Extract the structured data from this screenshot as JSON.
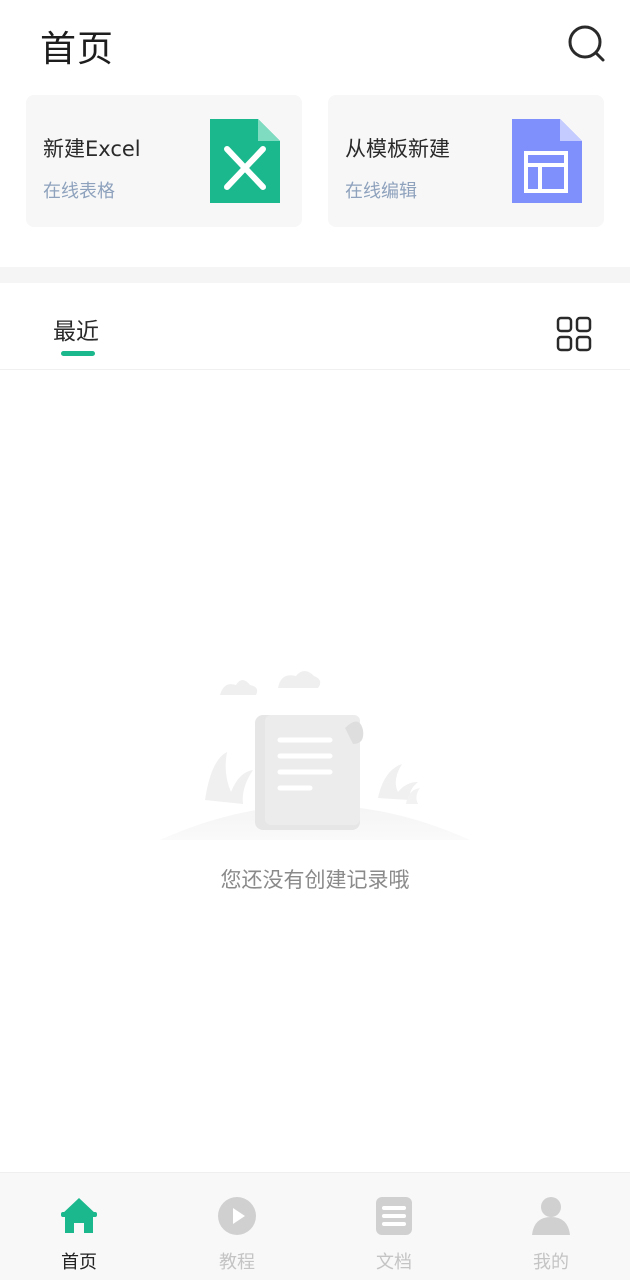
{
  "header": {
    "title": "首页"
  },
  "cards": [
    {
      "title": "新建Excel",
      "subtitle": "在线表格",
      "icon": "excel-file-icon",
      "color": "#1ab88c"
    },
    {
      "title": "从模板新建",
      "subtitle": "在线编辑",
      "icon": "template-file-icon",
      "color": "#7f8ffb"
    }
  ],
  "tabs": {
    "recent": "最近"
  },
  "empty_state": {
    "text": "您还没有创建记录哦",
    "icon": "empty-scroll-icon"
  },
  "bottom_nav": {
    "items": [
      {
        "label": "首页",
        "icon": "home-icon",
        "active": true
      },
      {
        "label": "教程",
        "icon": "play-icon",
        "active": false
      },
      {
        "label": "文档",
        "icon": "document-icon",
        "active": false
      },
      {
        "label": "我的",
        "icon": "user-icon",
        "active": false
      }
    ]
  },
  "colors": {
    "accent": "#1ab88c",
    "template": "#7f8ffb",
    "subtitle": "#8ea2bd",
    "inactive": "#c4c4c4"
  }
}
